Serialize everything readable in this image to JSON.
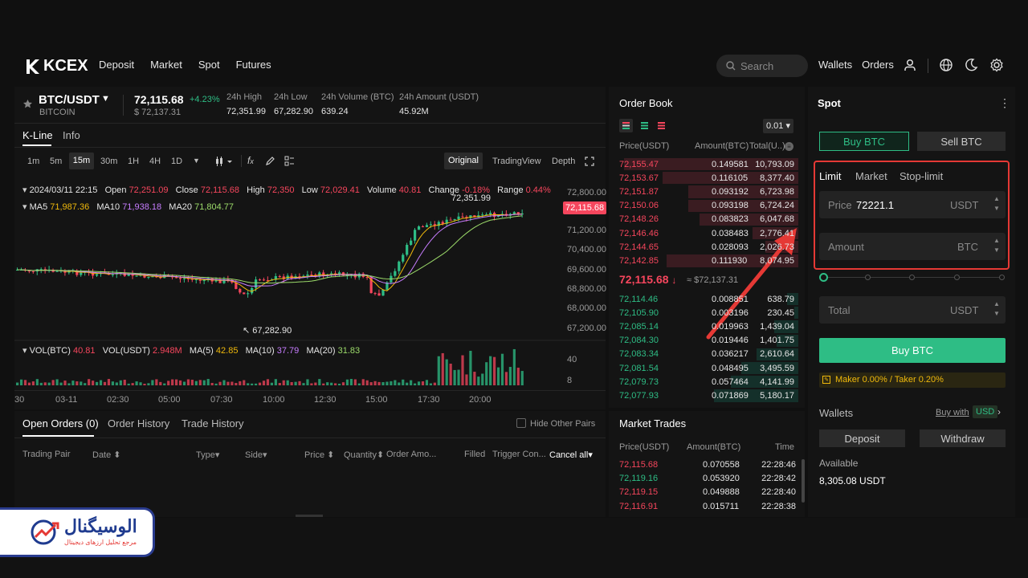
{
  "header": {
    "brand": "KCEX",
    "nav": [
      "Deposit",
      "Market",
      "Spot",
      "Futures"
    ],
    "search_placeholder": "Search",
    "wallets": "Wallets",
    "orders": "Orders"
  },
  "ticker": {
    "pair": "BTC/USDT",
    "name": "BITCOIN",
    "price": "72,115.68",
    "change": "+4.23%",
    "usd": "$ 72,137.31",
    "stats": [
      {
        "label": "24h High",
        "value": "72,351.99"
      },
      {
        "label": "24h Low",
        "value": "67,282.90"
      },
      {
        "label": "24h Volume (BTC)",
        "value": "639.24"
      },
      {
        "label": "24h Amount (USDT)",
        "value": "45.92M"
      }
    ]
  },
  "chart_tabs": [
    "K-Line",
    "Info"
  ],
  "intervals": [
    "1m",
    "5m",
    "15m",
    "30m",
    "1H",
    "4H",
    "1D"
  ],
  "active_interval": "15m",
  "views": [
    "Original",
    "TradingView",
    "Depth"
  ],
  "candle_info": {
    "date": "2024/03/11 22:15",
    "open_label": "Open",
    "open": "72,251.09",
    "close_label": "Close",
    "close": "72,115.68",
    "high_label": "High",
    "high": "72,350",
    "low_label": "Low",
    "low": "72,029.41",
    "vol_label": "Volume",
    "vol": "40.81",
    "chg_label": "Change",
    "chg": "-0.18%",
    "range_label": "Range",
    "range": "0.44%"
  },
  "ma": [
    {
      "label": "MA5",
      "value": "71,987.36",
      "color": "#f0b90b"
    },
    {
      "label": "MA10",
      "value": "71,938.18",
      "color": "#c77dff"
    },
    {
      "label": "MA20",
      "value": "71,804.77",
      "color": "#9cdb6a"
    }
  ],
  "vol_info": {
    "vbtc_label": "VOL(BTC)",
    "vbtc": "40.81",
    "vusdt_label": "VOL(USDT)",
    "vusdt": "2.948M",
    "ma5_label": "MA(5)",
    "ma5": "42.85",
    "ma10_label": "MA(10)",
    "ma10": "37.79",
    "ma20_label": "MA(20)",
    "ma20": "31.83"
  },
  "price_axis": [
    "72,800.00",
    "71,200.00",
    "70,400.00",
    "69,600.00",
    "68,800.00",
    "68,000.00",
    "67,200.00"
  ],
  "price_marker": "72,115.68",
  "high_marker": "72,351.99",
  "low_marker": "67,282.90",
  "vol_axis": [
    "40",
    "8"
  ],
  "time_axis": [
    "30",
    "03-11",
    "02:30",
    "05:00",
    "07:30",
    "10:00",
    "12:30",
    "15:00",
    "17:30",
    "20:00"
  ],
  "orders_tabs": [
    "Open Orders (0)",
    "Order History",
    "Trade History"
  ],
  "hide_other": "Hide Other Pairs",
  "orders_cols": [
    "Trading Pair",
    "Date",
    "Type",
    "Side",
    "Price",
    "Quantity",
    "Order Amo...",
    "Filled",
    "Trigger Con...",
    "Cancel all"
  ],
  "orderbook": {
    "title": "Order Book",
    "precision": "0.01",
    "cols": [
      "Price(USDT)",
      "Amount(BTC)",
      "Total(U..)"
    ],
    "asks": [
      [
        "72,155.47",
        "0.149581",
        "10,793.09",
        0.95
      ],
      [
        "72,153.67",
        "0.116105",
        "8,377.40",
        0.74
      ],
      [
        "72,151.87",
        "0.093192",
        "6,723.98",
        0.6
      ],
      [
        "72,150.06",
        "0.093198",
        "6,724.24",
        0.6
      ],
      [
        "72,148.26",
        "0.083823",
        "6,047.68",
        0.54
      ],
      [
        "72,146.46",
        "0.038483",
        "2,776.41",
        0.25
      ],
      [
        "72,144.65",
        "0.028093",
        "2,026.73",
        0.18
      ],
      [
        "72,142.85",
        "0.111930",
        "8,074.95",
        0.72
      ]
    ],
    "mid": "72,115.68",
    "mid_usd": "≈ $72,137.31",
    "bids": [
      [
        "72,114.46",
        "0.008851",
        "638.79",
        0.06
      ],
      [
        "72,105.90",
        "0.003196",
        "230.45",
        0.02
      ],
      [
        "72,085.14",
        "0.019963",
        "1,439.04",
        0.13
      ],
      [
        "72,084.30",
        "0.019446",
        "1,401.75",
        0.12
      ],
      [
        "72,083.34",
        "0.036217",
        "2,610.64",
        0.23
      ],
      [
        "72,081.54",
        "0.048495",
        "3,495.59",
        0.31
      ],
      [
        "72,079.73",
        "0.057464",
        "4,141.99",
        0.37
      ],
      [
        "72,077.93",
        "0.071869",
        "5,180.17",
        0.46
      ]
    ]
  },
  "trades": {
    "title": "Market Trades",
    "cols": [
      "Price(USDT)",
      "Amount(BTC)",
      "Time"
    ],
    "rows": [
      [
        "72,115.68",
        "0.070558",
        "22:28:46",
        "red"
      ],
      [
        "72,119.16",
        "0.053920",
        "22:28:42",
        "green"
      ],
      [
        "72,119.15",
        "0.049888",
        "22:28:40",
        "red"
      ],
      [
        "72,116.91",
        "0.015711",
        "22:28:38",
        "red"
      ]
    ]
  },
  "spot": {
    "title": "Spot",
    "buy_tab": "Buy BTC",
    "sell_tab": "Sell BTC",
    "order_types": [
      "Limit",
      "Market",
      "Stop-limit"
    ],
    "price_label": "Price",
    "price_value": "72221.1",
    "price_unit": "USDT",
    "amount_label": "Amount",
    "amount_unit": "BTC",
    "total_label": "Total",
    "total_unit": "USDT",
    "buy_button": "Buy BTC",
    "fee": "Maker 0.00% / Taker 0.20%",
    "wallets_title": "Wallets",
    "buy_with": "Buy with",
    "currency": "USD",
    "deposit": "Deposit",
    "withdraw": "Withdraw",
    "available_label": "Available",
    "available_value": "8,305.08 USDT"
  },
  "watermark": {
    "title": "الوسيگنال",
    "subtitle": "مرجع تحلیل ارزهای دیجیتال"
  },
  "colors": {
    "up": "#2ebd85",
    "down": "#f6465d",
    "accent": "#2ebd85",
    "highlight": "#e53935"
  }
}
